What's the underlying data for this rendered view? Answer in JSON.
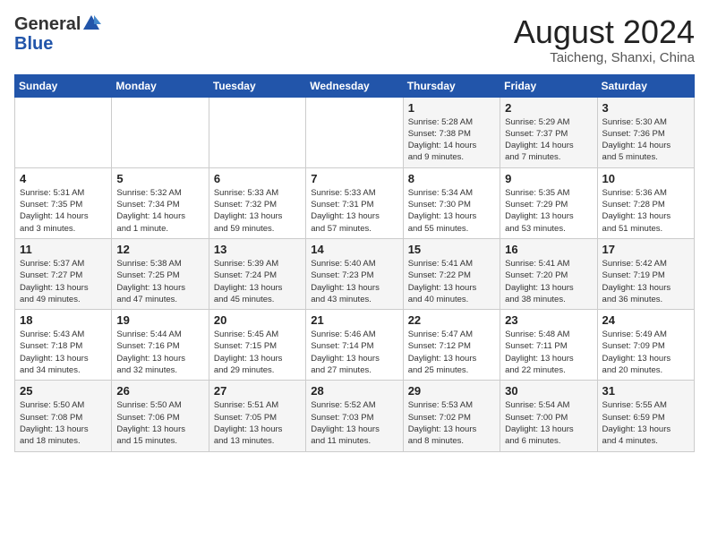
{
  "header": {
    "logo_general": "General",
    "logo_blue": "Blue",
    "month": "August 2024",
    "location": "Taicheng, Shanxi, China"
  },
  "weekdays": [
    "Sunday",
    "Monday",
    "Tuesday",
    "Wednesday",
    "Thursday",
    "Friday",
    "Saturday"
  ],
  "weeks": [
    [
      {
        "day": "",
        "info": ""
      },
      {
        "day": "",
        "info": ""
      },
      {
        "day": "",
        "info": ""
      },
      {
        "day": "",
        "info": ""
      },
      {
        "day": "1",
        "info": "Sunrise: 5:28 AM\nSunset: 7:38 PM\nDaylight: 14 hours\nand 9 minutes."
      },
      {
        "day": "2",
        "info": "Sunrise: 5:29 AM\nSunset: 7:37 PM\nDaylight: 14 hours\nand 7 minutes."
      },
      {
        "day": "3",
        "info": "Sunrise: 5:30 AM\nSunset: 7:36 PM\nDaylight: 14 hours\nand 5 minutes."
      }
    ],
    [
      {
        "day": "4",
        "info": "Sunrise: 5:31 AM\nSunset: 7:35 PM\nDaylight: 14 hours\nand 3 minutes."
      },
      {
        "day": "5",
        "info": "Sunrise: 5:32 AM\nSunset: 7:34 PM\nDaylight: 14 hours\nand 1 minute."
      },
      {
        "day": "6",
        "info": "Sunrise: 5:33 AM\nSunset: 7:32 PM\nDaylight: 13 hours\nand 59 minutes."
      },
      {
        "day": "7",
        "info": "Sunrise: 5:33 AM\nSunset: 7:31 PM\nDaylight: 13 hours\nand 57 minutes."
      },
      {
        "day": "8",
        "info": "Sunrise: 5:34 AM\nSunset: 7:30 PM\nDaylight: 13 hours\nand 55 minutes."
      },
      {
        "day": "9",
        "info": "Sunrise: 5:35 AM\nSunset: 7:29 PM\nDaylight: 13 hours\nand 53 minutes."
      },
      {
        "day": "10",
        "info": "Sunrise: 5:36 AM\nSunset: 7:28 PM\nDaylight: 13 hours\nand 51 minutes."
      }
    ],
    [
      {
        "day": "11",
        "info": "Sunrise: 5:37 AM\nSunset: 7:27 PM\nDaylight: 13 hours\nand 49 minutes."
      },
      {
        "day": "12",
        "info": "Sunrise: 5:38 AM\nSunset: 7:25 PM\nDaylight: 13 hours\nand 47 minutes."
      },
      {
        "day": "13",
        "info": "Sunrise: 5:39 AM\nSunset: 7:24 PM\nDaylight: 13 hours\nand 45 minutes."
      },
      {
        "day": "14",
        "info": "Sunrise: 5:40 AM\nSunset: 7:23 PM\nDaylight: 13 hours\nand 43 minutes."
      },
      {
        "day": "15",
        "info": "Sunrise: 5:41 AM\nSunset: 7:22 PM\nDaylight: 13 hours\nand 40 minutes."
      },
      {
        "day": "16",
        "info": "Sunrise: 5:41 AM\nSunset: 7:20 PM\nDaylight: 13 hours\nand 38 minutes."
      },
      {
        "day": "17",
        "info": "Sunrise: 5:42 AM\nSunset: 7:19 PM\nDaylight: 13 hours\nand 36 minutes."
      }
    ],
    [
      {
        "day": "18",
        "info": "Sunrise: 5:43 AM\nSunset: 7:18 PM\nDaylight: 13 hours\nand 34 minutes."
      },
      {
        "day": "19",
        "info": "Sunrise: 5:44 AM\nSunset: 7:16 PM\nDaylight: 13 hours\nand 32 minutes."
      },
      {
        "day": "20",
        "info": "Sunrise: 5:45 AM\nSunset: 7:15 PM\nDaylight: 13 hours\nand 29 minutes."
      },
      {
        "day": "21",
        "info": "Sunrise: 5:46 AM\nSunset: 7:14 PM\nDaylight: 13 hours\nand 27 minutes."
      },
      {
        "day": "22",
        "info": "Sunrise: 5:47 AM\nSunset: 7:12 PM\nDaylight: 13 hours\nand 25 minutes."
      },
      {
        "day": "23",
        "info": "Sunrise: 5:48 AM\nSunset: 7:11 PM\nDaylight: 13 hours\nand 22 minutes."
      },
      {
        "day": "24",
        "info": "Sunrise: 5:49 AM\nSunset: 7:09 PM\nDaylight: 13 hours\nand 20 minutes."
      }
    ],
    [
      {
        "day": "25",
        "info": "Sunrise: 5:50 AM\nSunset: 7:08 PM\nDaylight: 13 hours\nand 18 minutes."
      },
      {
        "day": "26",
        "info": "Sunrise: 5:50 AM\nSunset: 7:06 PM\nDaylight: 13 hours\nand 15 minutes."
      },
      {
        "day": "27",
        "info": "Sunrise: 5:51 AM\nSunset: 7:05 PM\nDaylight: 13 hours\nand 13 minutes."
      },
      {
        "day": "28",
        "info": "Sunrise: 5:52 AM\nSunset: 7:03 PM\nDaylight: 13 hours\nand 11 minutes."
      },
      {
        "day": "29",
        "info": "Sunrise: 5:53 AM\nSunset: 7:02 PM\nDaylight: 13 hours\nand 8 minutes."
      },
      {
        "day": "30",
        "info": "Sunrise: 5:54 AM\nSunset: 7:00 PM\nDaylight: 13 hours\nand 6 minutes."
      },
      {
        "day": "31",
        "info": "Sunrise: 5:55 AM\nSunset: 6:59 PM\nDaylight: 13 hours\nand 4 minutes."
      }
    ]
  ]
}
